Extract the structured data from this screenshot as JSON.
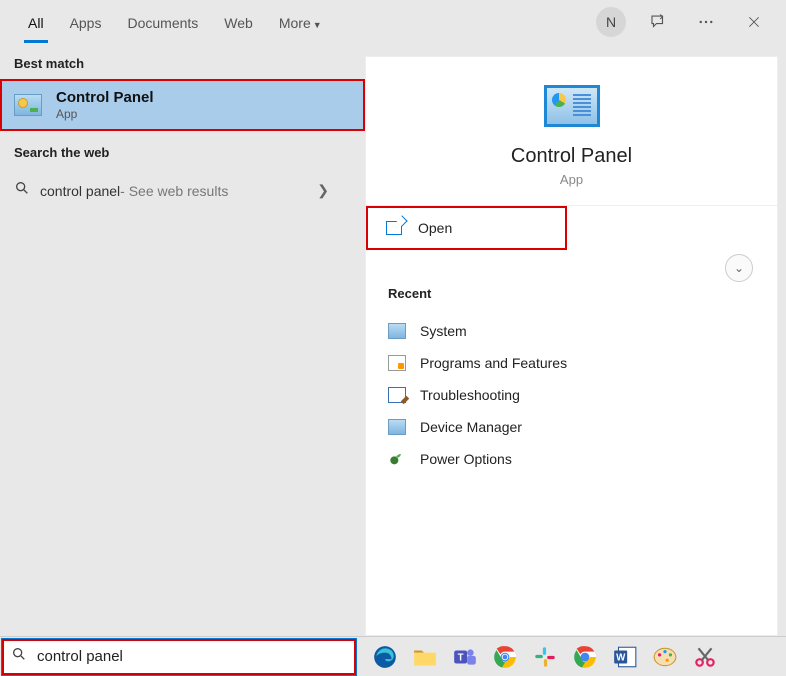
{
  "titlebar": {
    "tabs": [
      "All",
      "Apps",
      "Documents",
      "Web",
      "More"
    ],
    "avatar_initial": "N"
  },
  "left": {
    "best_match_header": "Best match",
    "best_match": {
      "title": "Control Panel",
      "subtitle": "App"
    },
    "search_web_header": "Search the web",
    "web_result": {
      "query": "control panel",
      "suffix": " - See web results"
    }
  },
  "detail": {
    "title": "Control Panel",
    "subtitle": "App",
    "open_label": "Open",
    "recent_header": "Recent",
    "recent_items": [
      "System",
      "Programs and Features",
      "Troubleshooting",
      "Device Manager",
      "Power Options"
    ]
  },
  "search": {
    "value": "control panel"
  },
  "taskbar_apps": [
    "edge",
    "explorer",
    "teams",
    "chrome",
    "slack",
    "chrome-alt",
    "word",
    "paint",
    "snip"
  ]
}
